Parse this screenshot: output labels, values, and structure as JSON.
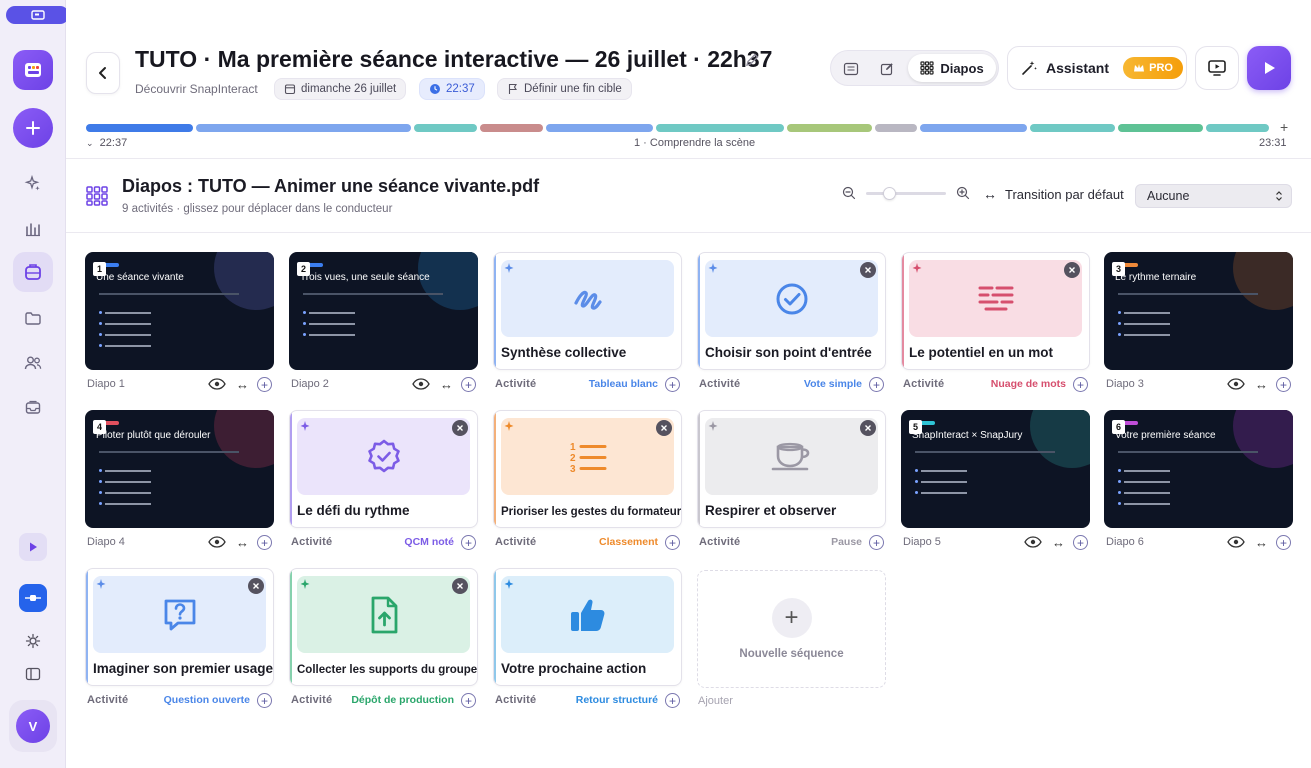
{
  "header": {
    "title": "TUTO · Ma première séance interactive — 26 juillet · 22h37",
    "subtitle": "Découvrir SnapInteract",
    "chips": {
      "date": "dimanche 26 juillet",
      "time": "22:37",
      "end": "Définir une fin cible"
    },
    "views": {
      "active": "Diapos"
    },
    "assistant": {
      "label": "Assistant",
      "badge": "PRO"
    }
  },
  "timeline": {
    "start": "22:37",
    "current": "1 · Comprendre la scène",
    "end": "23:31",
    "segments": [
      {
        "color": "#3f7be8"
      },
      {
        "color": "#7ea6ee"
      },
      {
        "color": "#6fc9c4"
      },
      {
        "color": "#c98c8c"
      },
      {
        "color": "#7ea6ee"
      },
      {
        "color": "#6fc9c4"
      },
      {
        "color": "#a7c77a"
      },
      {
        "color": "#b9b7c2"
      },
      {
        "color": "#7ea6ee"
      },
      {
        "color": "#6fc9c4"
      },
      {
        "color": "#5ec295"
      },
      {
        "color": "#6fc9c4"
      }
    ]
  },
  "section": {
    "title": "Diapos : TUTO — Animer une séance vivante.pdf",
    "subtitle": "9 activités · glissez pour déplacer dans le conducteur",
    "transition_label": "Transition par défaut",
    "transition_value": "Aucune",
    "zoom_level": 0.25
  },
  "row1": {
    "c1": {
      "num": "1",
      "title": "Une séance vivante",
      "label": "Diapo 1"
    },
    "c2": {
      "num": "2",
      "title": "Trois vues, une seule séance",
      "label": "Diapo 2"
    },
    "c3": {
      "name": "Synthèse collective",
      "kind": "Activité",
      "type": "Tableau blanc"
    },
    "c4": {
      "name": "Choisir son point d'entrée",
      "kind": "Activité",
      "type": "Vote simple"
    },
    "c5": {
      "name": "Le potentiel en un mot",
      "kind": "Activité",
      "type": "Nuage de mots"
    },
    "c6": {
      "num": "3",
      "title": "Le rythme ternaire",
      "label": "Diapo 3"
    }
  },
  "row2": {
    "c1": {
      "num": "4",
      "title": "Piloter plutôt que dérouler",
      "label": "Diapo 4"
    },
    "c2": {
      "name": "Le défi du rythme",
      "kind": "Activité",
      "type": "QCM noté"
    },
    "c3": {
      "name": "Prioriser les gestes du formateur",
      "kind": "Activité",
      "type": "Classement"
    },
    "c4": {
      "name": "Respirer et observer",
      "kind": "Activité",
      "type": "Pause"
    },
    "c5": {
      "num": "5",
      "title": "SnapInteract × SnapJury",
      "label": "Diapo 5"
    },
    "c6": {
      "num": "6",
      "title": "Votre première séance",
      "label": "Diapo 6"
    }
  },
  "row3": {
    "c1": {
      "name": "Imaginer son premier usage",
      "kind": "Activité",
      "type": "Question ouverte"
    },
    "c2": {
      "name": "Collecter les supports du groupe",
      "kind": "Activité",
      "type": "Dépôt de production"
    },
    "c3": {
      "name": "Votre prochaine action",
      "kind": "Activité",
      "type": "Retour structuré"
    },
    "new_label": "Nouvelle séquence",
    "add_label": "Ajouter"
  },
  "sidebar": {
    "avatar": "V"
  },
  "colors": {
    "accent": "#6d42e6",
    "blue": "#4a86e8",
    "pink": "#d64f6e",
    "orange": "#ee8a2b",
    "green": "#2aa66b",
    "gray": "#9b98a4",
    "violet": "#7c5ce6"
  }
}
